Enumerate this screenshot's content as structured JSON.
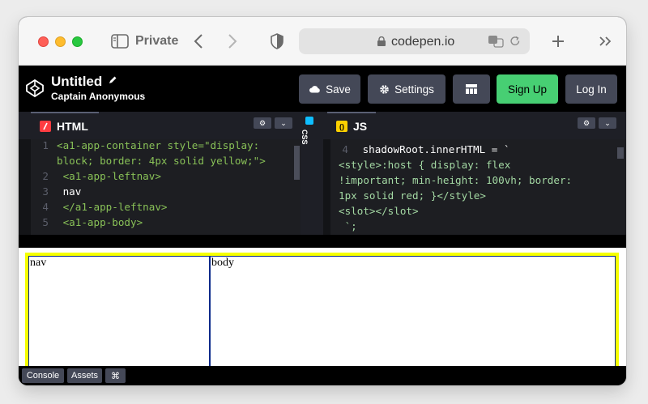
{
  "browser": {
    "private_label": "Private",
    "url": "codepen.io"
  },
  "header": {
    "title": "Untitled",
    "author": "Captain Anonymous",
    "buttons": {
      "save": "Save",
      "settings": "Settings",
      "signup": "Sign Up",
      "login": "Log In"
    }
  },
  "editors": {
    "html": {
      "label": "HTML",
      "lines": [
        {
          "num": "1",
          "code": "<a1-app-container style=\"display:"
        },
        {
          "num": "",
          "code": "block; border: 4px solid yellow;\">"
        },
        {
          "num": "2",
          "code": "  <a1-app-leftnav>"
        },
        {
          "num": "3",
          "code": "    nav"
        },
        {
          "num": "4",
          "code": "  </a1-app-leftnav>"
        },
        {
          "num": "5",
          "code": "  <a1-app-body>"
        }
      ]
    },
    "css": {
      "label": "CSS"
    },
    "js": {
      "label": "JS",
      "lines": [
        {
          "num": "4",
          "code": "    shadowRoot.innerHTML = `"
        },
        {
          "num": "5",
          "code": "<style>:host { display: flex"
        },
        {
          "num": "",
          "code": "!important; min-height: 100vh; border:"
        },
        {
          "num": "",
          "code": "1px solid red; }</style>"
        },
        {
          "num": "",
          "code": "<slot></slot>"
        },
        {
          "num": "",
          "code": "    `;"
        }
      ]
    }
  },
  "preview": {
    "nav_text": "nav",
    "body_text": "body"
  },
  "footer": {
    "console": "Console",
    "assets": "Assets",
    "shortcuts": "⌘"
  }
}
